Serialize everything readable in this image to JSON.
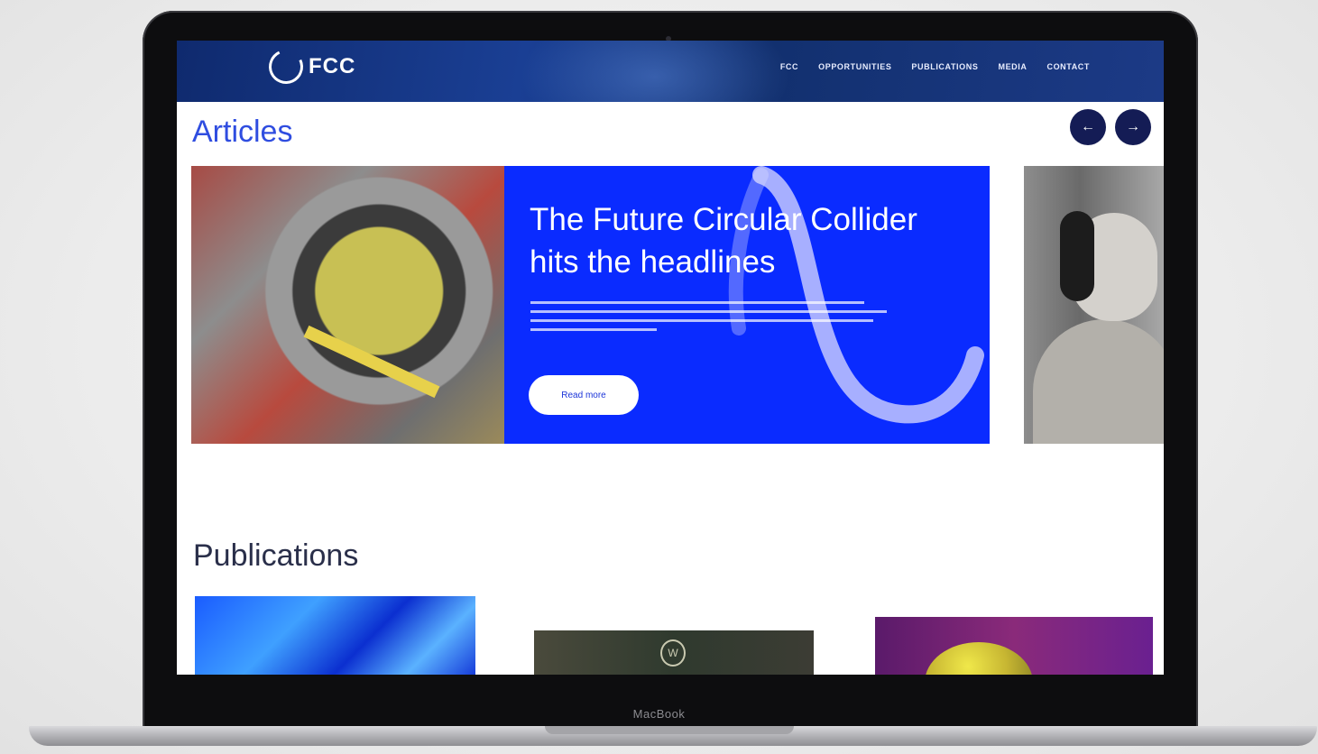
{
  "device": {
    "label": "MacBook"
  },
  "site": {
    "logo_text": "FCC",
    "nav": [
      "FCC",
      "OPPORTUNITIES",
      "PUBLICATIONS",
      "MEDIA",
      "CONTACT"
    ]
  },
  "articles": {
    "title": "Articles",
    "prev_icon": "arrow-left-icon",
    "next_icon": "arrow-right-icon",
    "prev_glyph": "←",
    "next_glyph": "→",
    "featured": {
      "title": "The Future Circular Collider hits the headlines",
      "read_more": "Read more"
    }
  },
  "publications": {
    "title": "Publications"
  },
  "colors": {
    "accent_blue": "#0a2bff",
    "navy": "#141c55",
    "title_blue": "#2f4de0"
  }
}
